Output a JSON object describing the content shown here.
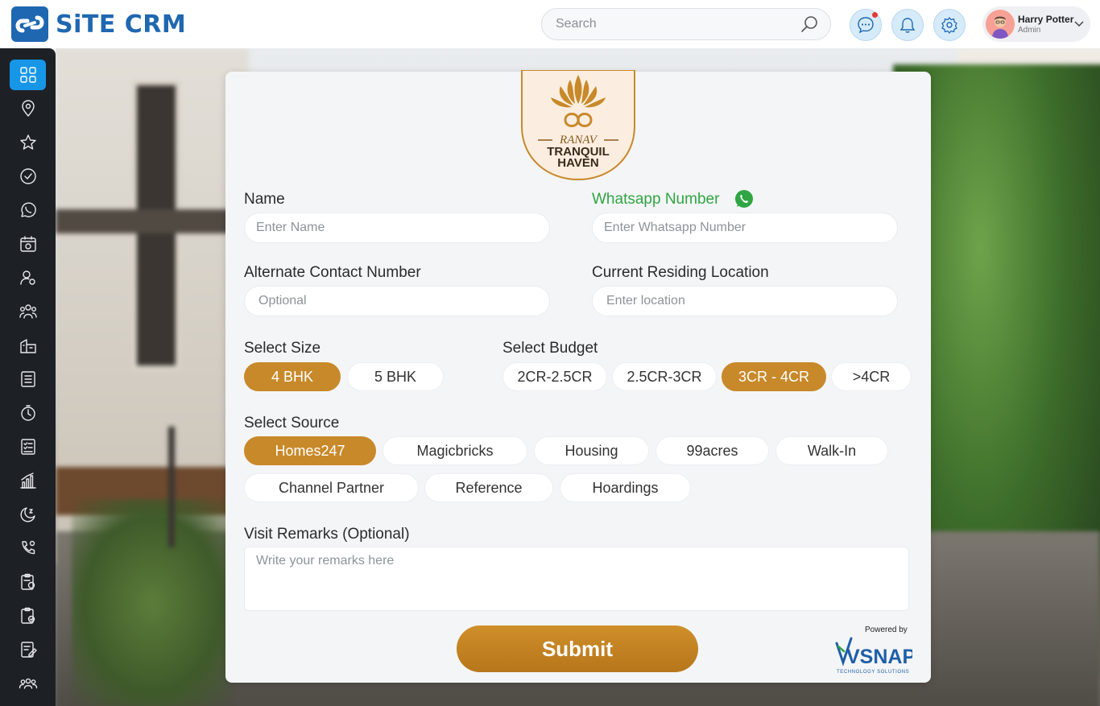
{
  "app": {
    "brand": "SiTE CRM",
    "search_placeholder": "Search",
    "user": {
      "name": "Harry Potter",
      "role": "Admin"
    }
  },
  "topbar_icons": [
    "chat-icon",
    "bell-icon",
    "settings-icon"
  ],
  "sidebar": {
    "items": [
      {
        "icon": "dashboard-grid-icon",
        "active": true
      },
      {
        "icon": "location-pin-icon"
      },
      {
        "icon": "star-icon"
      },
      {
        "icon": "check-circle-icon"
      },
      {
        "icon": "whatsapp-icon"
      },
      {
        "icon": "calendar-icon"
      },
      {
        "icon": "user-settings-icon"
      },
      {
        "icon": "team-icon"
      },
      {
        "icon": "building-icon"
      },
      {
        "icon": "ledger-icon"
      },
      {
        "icon": "stopwatch-icon"
      },
      {
        "icon": "checklist-icon"
      },
      {
        "icon": "bar-chart-icon"
      },
      {
        "icon": "moon-icon"
      },
      {
        "icon": "phone-settings-icon"
      },
      {
        "icon": "clipboard-settings-icon"
      },
      {
        "icon": "clipboard-check-icon"
      },
      {
        "icon": "edit-document-icon"
      },
      {
        "icon": "group-icon"
      }
    ]
  },
  "form": {
    "emblem": {
      "line1": "RANAV",
      "line2": "TRANQUIL",
      "line3": "HAVEN"
    },
    "name_label": "Name",
    "name_placeholder": "Enter Name",
    "whatsapp_label": "Whatsapp Number",
    "whatsapp_placeholder": "Enter Whatsapp Number",
    "alt_label": "Alternate Contact Number",
    "alt_placeholder": "Optional",
    "location_label": "Current Residing Location",
    "location_placeholder": "Enter location",
    "size_label": "Select Size",
    "sizes": [
      "4 BHK",
      "5 BHK"
    ],
    "size_selected": "4 BHK",
    "budget_label": "Select Budget",
    "budgets": [
      "2CR-2.5CR",
      "2.5CR-3CR",
      "3CR - 4CR",
      ">4CR"
    ],
    "budget_selected": "3CR - 4CR",
    "source_label": "Select Source",
    "sources": [
      "Homes247",
      "Magicbricks",
      "Housing",
      "99acres",
      "Walk-In",
      "Channel Partner",
      "Reference",
      "Hoardings"
    ],
    "source_selected": "Homes247",
    "remarks_label": "Visit Remarks (Optional)",
    "remarks_placeholder": "Write your remarks here",
    "submit_label": "Submit",
    "powered_by": "Powered by",
    "vsnap_name": "VSNAP",
    "vsnap_tagline": "TECHNOLOGY SOLUTIONS"
  },
  "colors": {
    "brand_blue": "#1f67b1",
    "accent_gold": "#c8892a",
    "sidebar_bg": "#1d2126",
    "sidebar_active": "#1796e8",
    "whatsapp_green": "#2fa643"
  }
}
